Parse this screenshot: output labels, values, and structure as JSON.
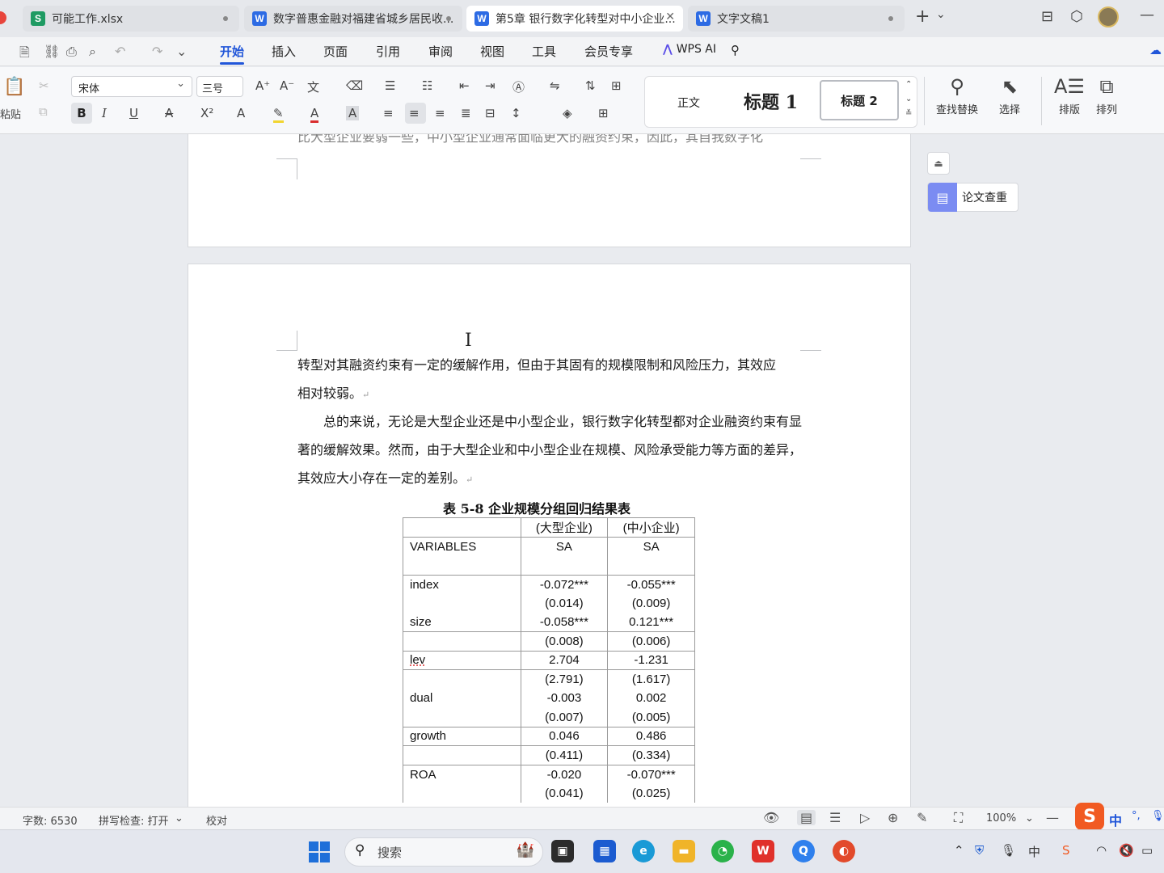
{
  "tabs": [
    {
      "icon": "S",
      "title": "可能工作.xlsx",
      "state": "dot"
    },
    {
      "icon": "W",
      "title": "数字普惠金融对福建省城乡居民收...",
      "state": "dot"
    },
    {
      "icon": "W",
      "title": "第5章 银行数字化转型对中小企业...",
      "state": "close",
      "active": true
    },
    {
      "icon": "W",
      "title": "文字文稿1",
      "state": "dot"
    }
  ],
  "tabbar": {
    "new_tab": "+",
    "new_tab_menu": "⌄",
    "icons": {
      "win": "⊟",
      "cube": "⬡",
      "minimize": "—"
    }
  },
  "menu": {
    "items": [
      "开始",
      "插入",
      "页面",
      "引用",
      "审阅",
      "视图",
      "工具",
      "会员专享",
      "WPS AI"
    ],
    "active": "开始"
  },
  "ribbon": {
    "paste_label": "粘贴",
    "font_name": "宋体",
    "font_size": "三号",
    "styles": {
      "normal": "正文",
      "h1": "标题 1",
      "h2": "标题 2"
    },
    "find_replace": "查找替换",
    "select": "选择",
    "layout": "排版",
    "arrange": "排列"
  },
  "document": {
    "prev_page_partial": "比大型企业要弱一些，中小型企业通常面临更大的融资约束，因此，其自我数字化",
    "para1_line1": "转型对其融资约束有一定的缓解作用，但由于其固有的规模限制和风险压力，其效应",
    "para1_line2": "相对较弱。",
    "para2": "总的来说，无论是大型企业还是中小型企业，银行数字化转型都对企业融资约束有显著的缓解效果。然而，由于大型企业和中小型企业在规模、风险承受能力等方面的差异，其效应大小存在一定的差别。",
    "table_caption": "表 5-8  企业规模分组回归结果表",
    "table_rows": [
      {
        "c1": "",
        "c2": "(大型企业)",
        "c3": "(中小企业)"
      },
      {
        "c1": "VARIABLES",
        "c2": "SA",
        "c3": "SA"
      },
      {
        "c1": "",
        "c2": "",
        "c3": ""
      },
      {
        "c1": "index",
        "c2": "-0.072***",
        "c3": "-0.055***"
      },
      {
        "c1": "",
        "c2": "(0.014)",
        "c3": "(0.009)"
      },
      {
        "c1": "size",
        "c2": "-0.058***",
        "c3": "0.121***"
      },
      {
        "c1": "",
        "c2": "(0.008)",
        "c3": "(0.006)"
      },
      {
        "c1": "lev",
        "c2": "2.704",
        "c3": "-1.231"
      },
      {
        "c1": "",
        "c2": "(2.791)",
        "c3": "(1.617)"
      },
      {
        "c1": "dual",
        "c2": "-0.003",
        "c3": "0.002"
      },
      {
        "c1": "",
        "c2": "(0.007)",
        "c3": "(0.005)"
      },
      {
        "c1": "growth",
        "c2": "0.046",
        "c3": "0.486"
      },
      {
        "c1": "",
        "c2": "(0.411)",
        "c3": "(0.334)"
      },
      {
        "c1": "ROA",
        "c2": "-0.020",
        "c3": "-0.070***"
      },
      {
        "c1": "",
        "c2": "(0.041)",
        "c3": "(0.025)"
      }
    ],
    "side_tool": "论文查重"
  },
  "statusbar": {
    "word_count": "字数: 6530",
    "spell_check": "拼写检查: 打开",
    "proofread": "校对",
    "zoom": "100%",
    "ime": "中"
  },
  "taskbar": {
    "search_placeholder": "搜索"
  },
  "colors": {
    "accent": "#2156d9",
    "wps_red": "#e0312b",
    "excel_green": "#1f9b63",
    "word_blue": "#2d6be4"
  }
}
